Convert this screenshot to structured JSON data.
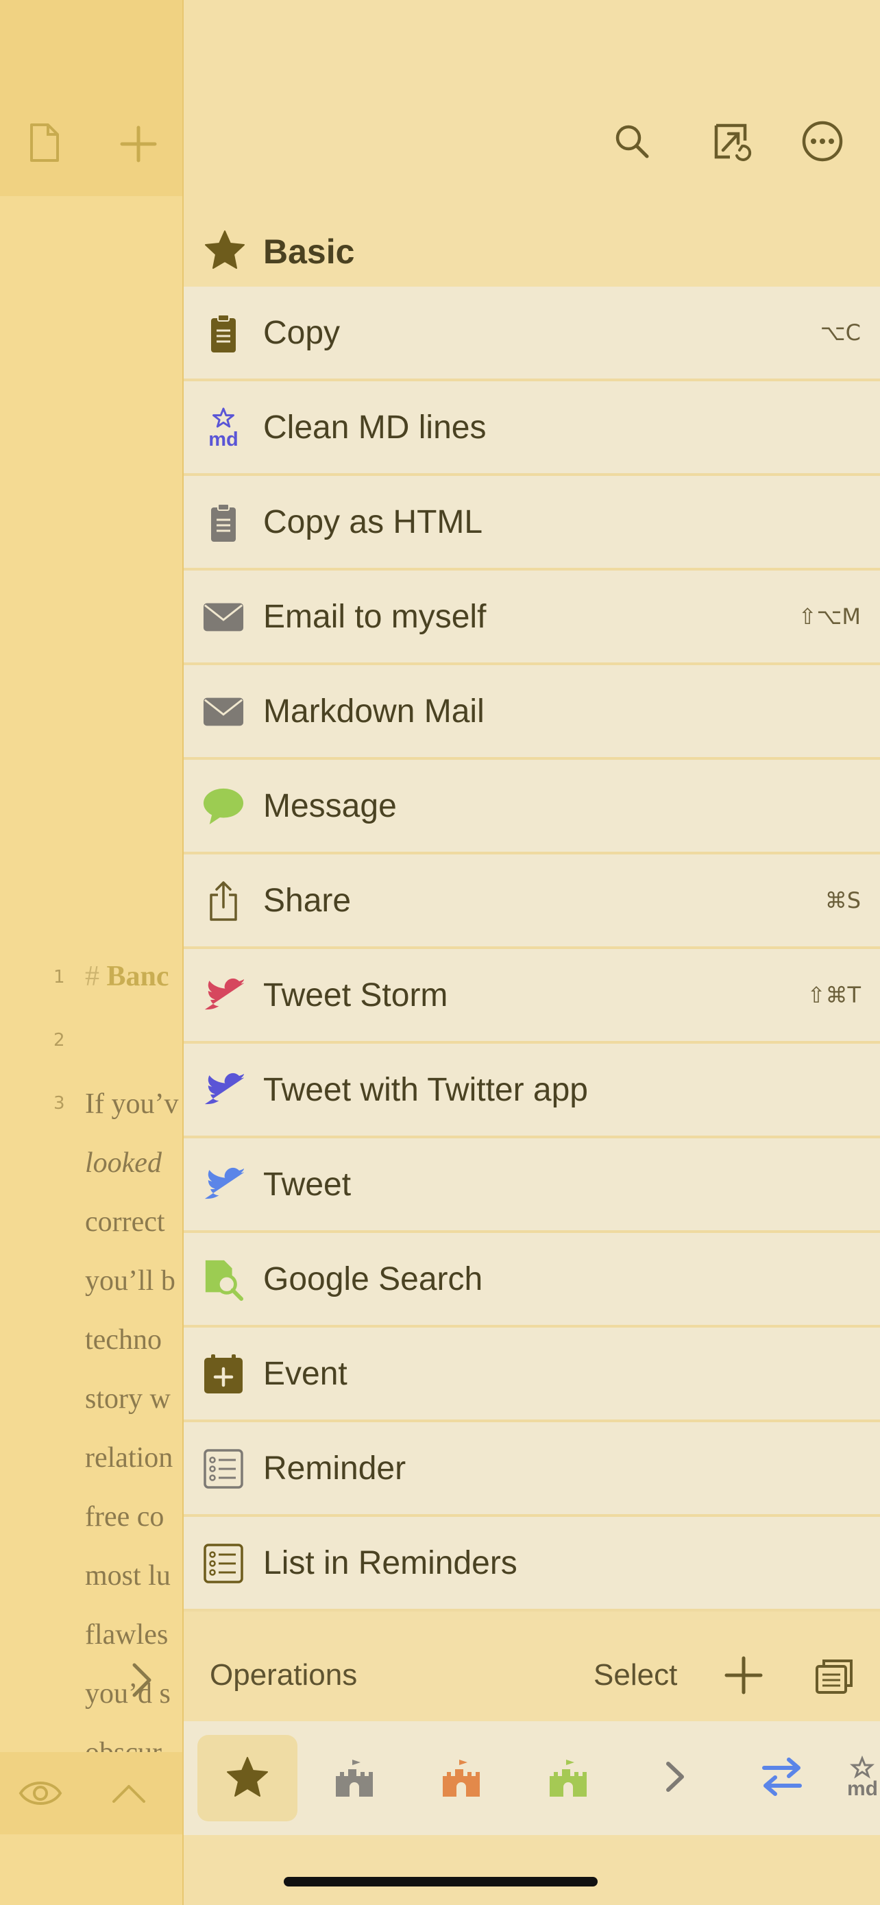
{
  "editor": {
    "line_numbers": [
      "1",
      "2",
      "3"
    ],
    "heading_hash": "#",
    "heading_text": "Banc",
    "body_lines": [
      "If you’v",
      "looked",
      "correct",
      "you’ll b",
      "techno",
      "story w",
      "relation",
      "free co",
      "most lu",
      "flawles",
      "you’d s",
      "obscur"
    ]
  },
  "panel": {
    "group_title": "Basic",
    "actions": [
      {
        "label": "Copy",
        "shortcut": "⌥C"
      },
      {
        "label": "Clean MD lines",
        "shortcut": ""
      },
      {
        "label": "Copy as HTML",
        "shortcut": ""
      },
      {
        "label": "Email to myself",
        "shortcut": "⇧⌥M"
      },
      {
        "label": "Markdown Mail",
        "shortcut": ""
      },
      {
        "label": "Message",
        "shortcut": ""
      },
      {
        "label": "Share",
        "shortcut": "⌘S"
      },
      {
        "label": "Tweet Storm",
        "shortcut": "⇧⌘T"
      },
      {
        "label": "Tweet with Twitter app",
        "shortcut": ""
      },
      {
        "label": "Tweet",
        "shortcut": ""
      },
      {
        "label": "Google Search",
        "shortcut": ""
      },
      {
        "label": "Event",
        "shortcut": ""
      },
      {
        "label": "Reminder",
        "shortcut": ""
      },
      {
        "label": "List in Reminders",
        "shortcut": ""
      }
    ],
    "ops_label": "Operations",
    "select_label": "Select",
    "md_icon_text": "md",
    "tabs": [
      "star-tab",
      "castle-gray-tab",
      "castle-orange-tab",
      "castle-green-tab",
      "chevron-tab",
      "swap-tab",
      "md-tab"
    ]
  },
  "colors": {
    "accent_olive": "#6e5c1c",
    "accent_blue": "#5b85e8",
    "twitter_red": "#d6475e",
    "twitter_purple": "#5a55d6",
    "message_green": "#9ccc52",
    "castle_orange": "#e3894a",
    "castle_green": "#a5c954"
  }
}
